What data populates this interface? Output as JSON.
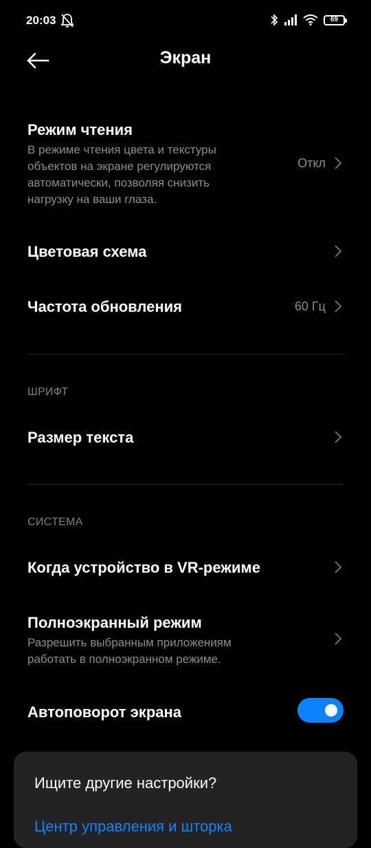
{
  "status": {
    "time": "20:03",
    "battery": "69",
    "icons": [
      "bell-off-icon",
      "bluetooth-icon",
      "signal-icon",
      "wifi-icon",
      "battery-icon"
    ]
  },
  "header": {
    "title": "Экран",
    "back_icon": "arrow-left-icon"
  },
  "settings": {
    "reading_mode": {
      "title": "Режим чтения",
      "subtitle_lines": [
        "В режиме чтения цвета и текстуры",
        "объектов на экране регулируются",
        "автоматически, позволяя снизить",
        "нагрузку на ваши глаза."
      ],
      "value": "Откл"
    },
    "color_scheme": {
      "title": "Цветовая схема"
    },
    "refresh_rate": {
      "title": "Частота обновления",
      "value": "60 Гц"
    },
    "font_section": "ШРИФТ",
    "text_size": {
      "title": "Размер текста"
    },
    "system_section": "СИСТЕМА",
    "vr_mode": {
      "title": "Когда устройство в VR-режиме"
    },
    "fullscreen": {
      "title": "Полноэкранный режим",
      "subtitle_lines": [
        "Разрешить выбранным приложениям",
        "работать в полноэкранном режиме."
      ]
    },
    "autorotate": {
      "title": "Автоповорот экрана",
      "enabled": true
    }
  },
  "card": {
    "title": "Ищите другие настройки?",
    "link": "Центр управления и шторка"
  },
  "colors": {
    "accent": "#0d84ff",
    "background": "#000000",
    "secondary_text": "#8c8c8c",
    "card_background": "#232323"
  }
}
